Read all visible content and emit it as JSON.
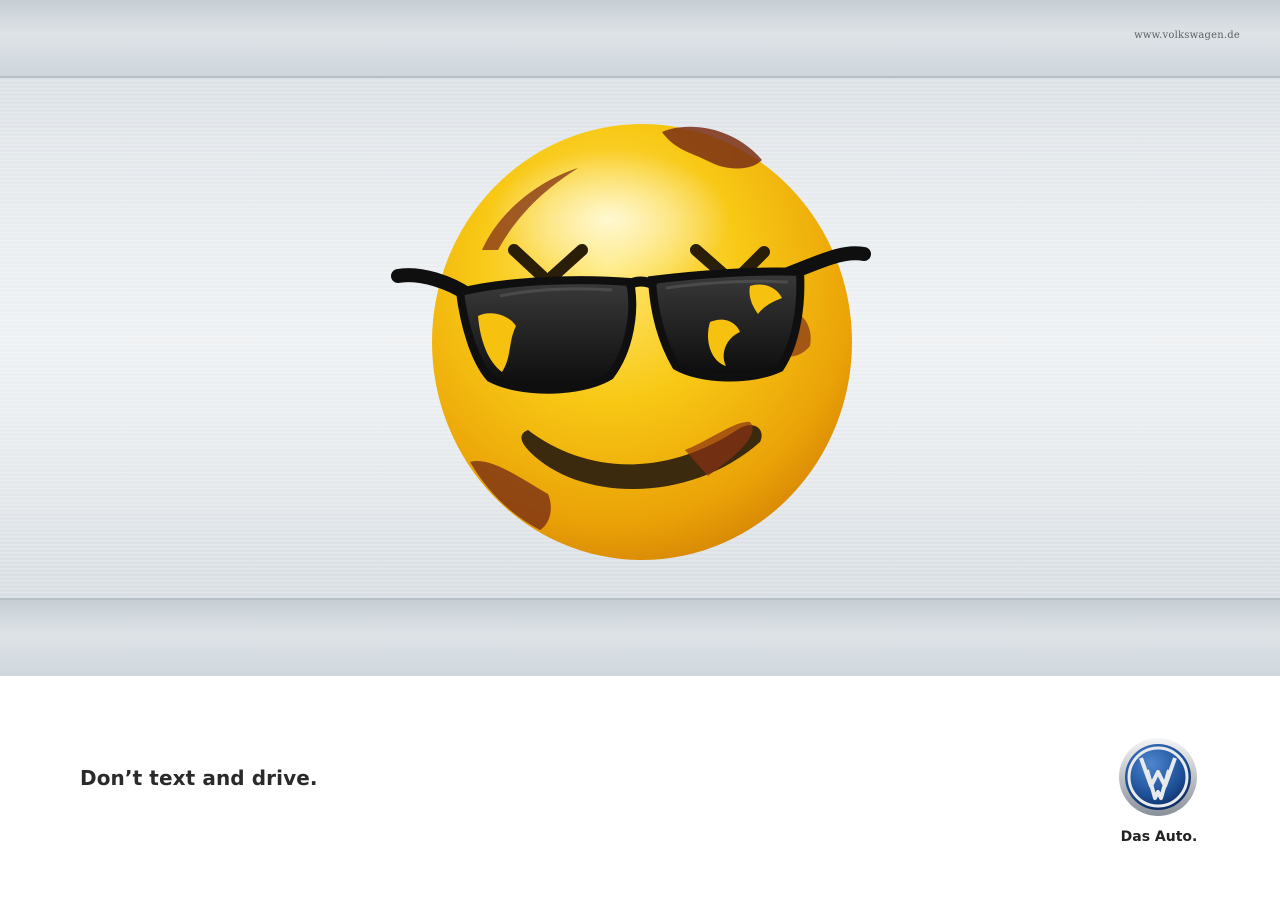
{
  "header": {
    "url": "www.volkswagen.de"
  },
  "footer": {
    "tagline": "Don’t text and drive.",
    "slogan": "Das Auto."
  },
  "colors": {
    "emoji_yellow": "#f6c10f",
    "emoji_orange": "#e69a06",
    "damage": "#7a2f14",
    "glasses": "#141414",
    "vw_blue": "#1d4f96"
  },
  "icons": {
    "emoji": "smiley-sunglasses-icon",
    "brand": "vw-logo-icon"
  }
}
